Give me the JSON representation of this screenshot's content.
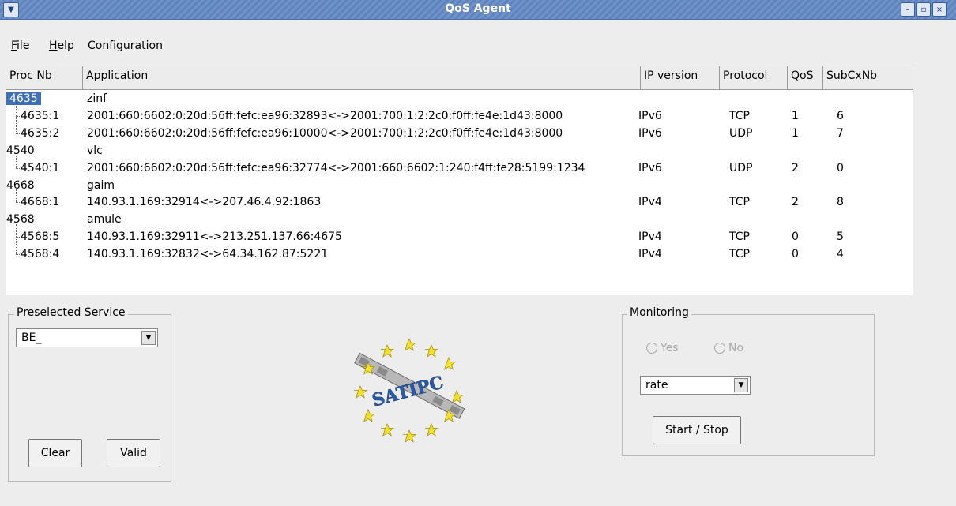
{
  "window": {
    "title": "QoS Agent"
  },
  "menubar": {
    "items": [
      {
        "label": "File",
        "underline": "F",
        "rest": "ile"
      },
      {
        "label": "Help",
        "underline": "H",
        "rest": "elp"
      },
      {
        "label": "Configuration"
      }
    ]
  },
  "table": {
    "headers": [
      "Proc Nb",
      "Application",
      "IP version",
      "Protocol",
      "QoS",
      "SubCxNb"
    ],
    "rows": [
      {
        "proc": "4635",
        "app": "zinf",
        "ip": "",
        "proto": "",
        "qos": "",
        "sub": "",
        "child": false,
        "selected": true
      },
      {
        "proc": "4635:1",
        "app": "2001:660:6602:0:20d:56ff:fefc:ea96:32893<->2001:700:1:2:2c0:f0ff:fe4e:1d43:8000",
        "ip": "IPv6",
        "proto": "TCP",
        "qos": "1",
        "sub": "6",
        "child": true,
        "last": false
      },
      {
        "proc": "4635:2",
        "app": "2001:660:6602:0:20d:56ff:fefc:ea96:10000<->2001:700:1:2:2c0:f0ff:fe4e:1d43:8000",
        "ip": "IPv6",
        "proto": "UDP",
        "qos": "1",
        "sub": "7",
        "child": true,
        "last": true
      },
      {
        "proc": "4540",
        "app": "vlc",
        "ip": "",
        "proto": "",
        "qos": "",
        "sub": "",
        "child": false
      },
      {
        "proc": "4540:1",
        "app": "2001:660:6602:0:20d:56ff:fefc:ea96:32774<->2001:660:6602:1:240:f4ff:fe28:5199:1234",
        "ip": "IPv6",
        "proto": "UDP",
        "qos": "2",
        "sub": "0",
        "child": true,
        "last": true
      },
      {
        "proc": "4668",
        "app": "gaim",
        "ip": "",
        "proto": "",
        "qos": "",
        "sub": "",
        "child": false
      },
      {
        "proc": "4668:1",
        "app": "140.93.1.169:32914<->207.46.4.92:1863",
        "ip": "IPv4",
        "proto": "TCP",
        "qos": "2",
        "sub": "8",
        "child": true,
        "last": true
      },
      {
        "proc": "4568",
        "app": "amule",
        "ip": "",
        "proto": "",
        "qos": "",
        "sub": "",
        "child": false
      },
      {
        "proc": "4568:5",
        "app": "140.93.1.169:32911<->213.251.137.66:4675",
        "ip": "IPv4",
        "proto": "TCP",
        "qos": "0",
        "sub": "5",
        "child": true,
        "last": false
      },
      {
        "proc": "4568:4",
        "app": "140.93.1.169:32832<->64.34.162.87:5221",
        "ip": "IPv4",
        "proto": "TCP",
        "qos": "0",
        "sub": "4",
        "child": true,
        "last": true
      }
    ]
  },
  "preselected": {
    "legend": "Preselected Service",
    "value": "BE_",
    "clear_label": "Clear",
    "valid_label": "Valid"
  },
  "logo": {
    "text": "SATIPC"
  },
  "monitoring": {
    "legend": "Monitoring",
    "yes_label": "Yes",
    "no_label": "No",
    "select_value": "rate",
    "start_stop_label": "Start / Stop"
  },
  "colors": {
    "titlebar": "#6f93c9",
    "selection": "#3f6fb7",
    "star": "#f2e12a",
    "logo_text": "#2a5aa8"
  }
}
